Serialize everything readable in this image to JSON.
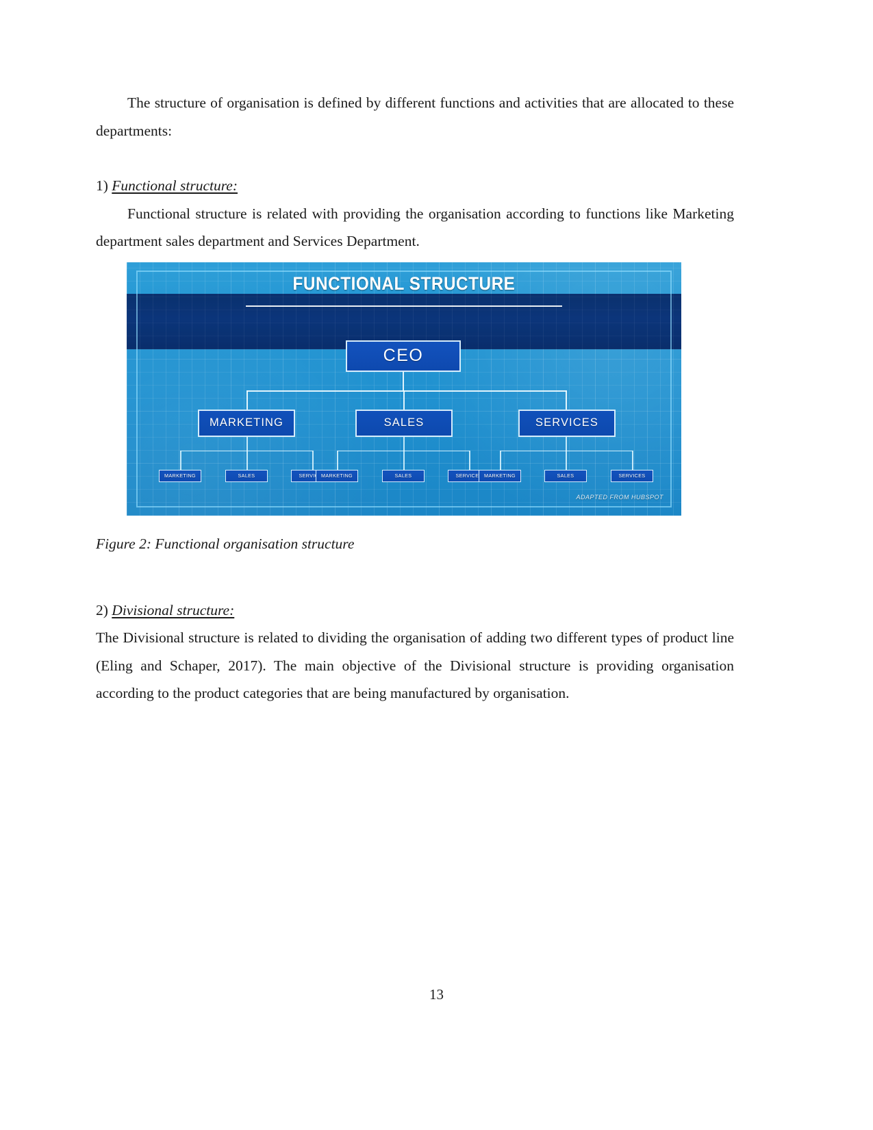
{
  "document": {
    "page_number": "13"
  },
  "intro": {
    "paragraph": "The structure of organisation is defined by different functions and activities that are allocated to these departments:"
  },
  "section_functional": {
    "number": "1)",
    "title": "Functional structure:",
    "paragraph": "Functional structure is related with providing the organisation according to functions like Marketing department sales department and Services Department."
  },
  "figure": {
    "caption": "Figure 2: Functional organisation structure",
    "credit": "ADAPTED FROM HUBSPOT",
    "chart_data": {
      "type": "diagram",
      "title": "FUNCTIONAL STRUCTURE",
      "diagram_kind": "org-chart",
      "root": "CEO",
      "level2": [
        "MARKETING",
        "SALES",
        "SERVICES"
      ],
      "level3_per_branch": [
        "MARKETING",
        "SALES",
        "SERVICES"
      ],
      "colors": {
        "background": "#2090cf",
        "header_band": "#0a3278",
        "node_fill": "#1150ba",
        "node_border": "#e2f5ff",
        "text": "#ffffff"
      }
    }
  },
  "section_divisional": {
    "number": "2)",
    "title": "Divisional structure:",
    "paragraph": "The Divisional structure is related to dividing the organisation of adding two different types of product line (Eling and Schaper, 2017). The main objective of the Divisional structure is providing organisation according to the product categories that are being manufactured by organisation."
  }
}
